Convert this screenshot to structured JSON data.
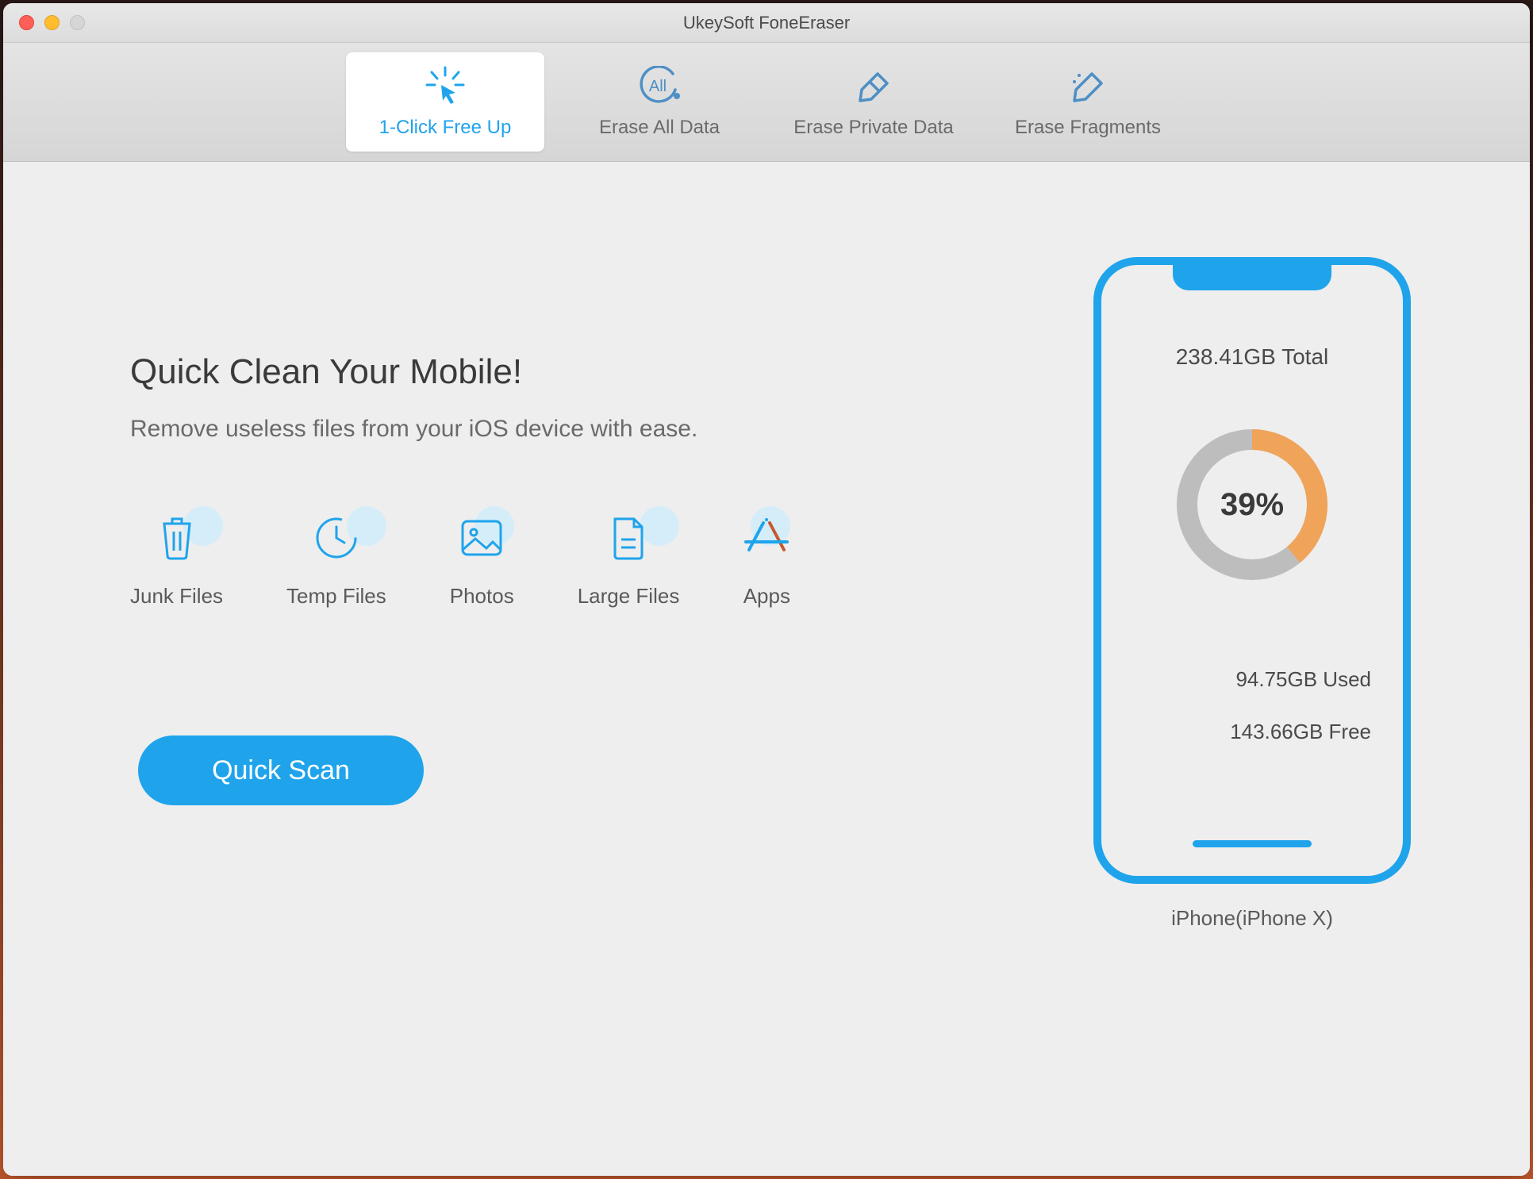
{
  "window": {
    "title": "UkeySoft FoneEraser"
  },
  "tabs": [
    {
      "label": "1-Click Free Up",
      "icon": "click-free-icon",
      "active": true
    },
    {
      "label": "Erase All Data",
      "icon": "erase-all-icon",
      "active": false
    },
    {
      "label": "Erase Private Data",
      "icon": "erase-private-icon",
      "active": false
    },
    {
      "label": "Erase Fragments",
      "icon": "erase-fragments-icon",
      "active": false
    }
  ],
  "main": {
    "heading": "Quick Clean Your Mobile!",
    "subheading": "Remove useless files from your iOS device with ease.",
    "categories": [
      {
        "label": "Junk Files",
        "icon": "trash-icon"
      },
      {
        "label": "Temp Files",
        "icon": "clock-icon"
      },
      {
        "label": "Photos",
        "icon": "photo-icon"
      },
      {
        "label": "Large Files",
        "icon": "file-icon"
      },
      {
        "label": "Apps",
        "icon": "apps-icon"
      }
    ],
    "scan_button": "Quick Scan"
  },
  "device": {
    "total": "238.41GB Total",
    "used_percent": 39,
    "used_percent_label": "39%",
    "used": "94.75GB Used",
    "free": "143.66GB Free",
    "name": "iPhone(iPhone X)"
  },
  "colors": {
    "accent": "#1fa4ec",
    "donut_used": "#f0a45a",
    "donut_bg": "#bdbdbd"
  }
}
